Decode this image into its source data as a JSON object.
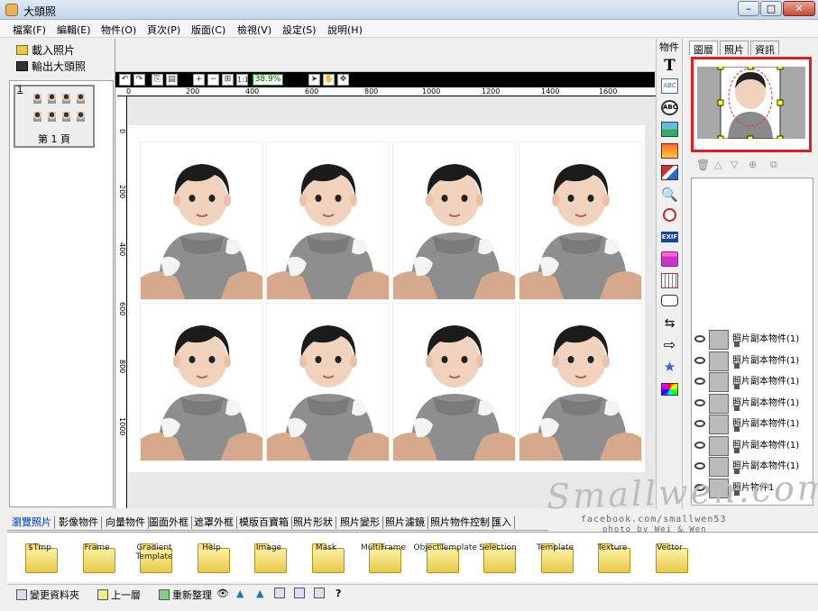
{
  "window": {
    "title": "大頭照"
  },
  "menu": [
    "檔案(F)",
    "編輯(E)",
    "物件(O)",
    "頁次(P)",
    "版面(C)",
    "檢視(V)",
    "設定(S)",
    "說明(H)"
  ],
  "left_panel": {
    "load_photo": "載入照片",
    "export_photo": "輸出大頭照",
    "page_number": "1",
    "page_label": "第 1 頁"
  },
  "toolbar": {
    "zoom": "38.9%"
  },
  "ruler": {
    "h_ticks": [
      "0",
      "200",
      "400",
      "600",
      "800",
      "1000",
      "1200",
      "1400",
      "1600"
    ],
    "v_ticks": [
      "0",
      "200",
      "400",
      "600",
      "800",
      "1000"
    ]
  },
  "icon_column": {
    "header": "物件",
    "icons": [
      "text-icon",
      "abc-label-icon",
      "abc-circle-icon",
      "landscape-image-icon",
      "sunset-image-icon",
      "frames-icon",
      "magnifier-icon",
      "clock-icon",
      "exif-icon",
      "cake-icon",
      "calendar-icon",
      "speech-bubble-icon",
      "arrows-icon",
      "arrow-right-icon",
      "star-icon",
      "color-grid-icon"
    ],
    "exif_text": "EXIF",
    "abc_text": "ABC"
  },
  "right_panel": {
    "tabs": [
      "圖層",
      "照片",
      "資訊"
    ],
    "objects": [
      "照片副本物件(1)",
      "照片副本物件(1)",
      "照片副本物件(1)",
      "照片副本物件(1)",
      "照片副本物件(1)",
      "照片副本物件(1)",
      "照片副本物件(1)",
      "照片物件1"
    ]
  },
  "bottom_tabs": [
    "瀏覽照片",
    "影像物件",
    "向量物件",
    "圖面外框",
    "遮罩外框",
    "模版百寶箱",
    "照片形狀",
    "照片變形",
    "照片濾鏡",
    "照片物件控制",
    "匯入"
  ],
  "folders": [
    "$Tmp",
    "Frame",
    "Gradient Template",
    "Help",
    "Image",
    "Mask",
    "MultiFrame",
    "ObjectTemplate",
    "Selection",
    "Template",
    "Texture",
    "Vector"
  ],
  "status": {
    "change_folder": "變更資料夾",
    "up_level": "上一層",
    "refresh": "重新整理",
    "help": "?"
  },
  "watermark": {
    "signature": "Smallwen.com",
    "facebook": "facebook.com/smallwen53",
    "credit": "photo by Wei & Wen"
  }
}
